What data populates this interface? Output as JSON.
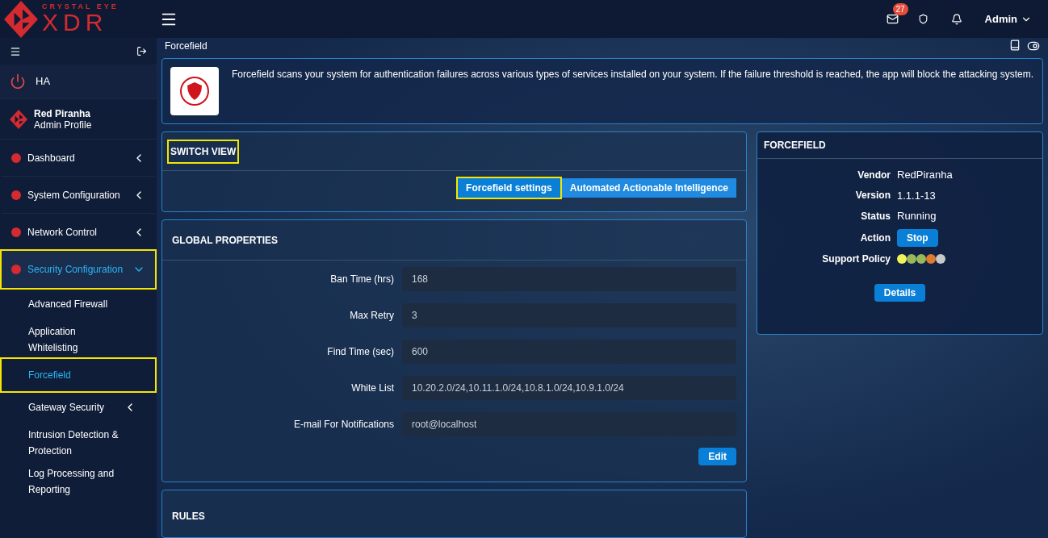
{
  "topbar": {
    "logo_top": "CRYSTAL EYE",
    "logo_main": "XDR",
    "mail_count": "27",
    "user": "Admin"
  },
  "sidebar": {
    "ha": "HA",
    "profile": {
      "name": "Red Piranha",
      "role": "Admin Profile"
    },
    "items": [
      {
        "label": "Dashboard",
        "expanded": false,
        "highlighted": false
      },
      {
        "label": "System Configuration",
        "expanded": false,
        "highlighted": false
      },
      {
        "label": "Network Control",
        "expanded": false,
        "highlighted": false
      },
      {
        "label": "Security Configuration",
        "expanded": true,
        "highlighted": true,
        "children": [
          {
            "label": "Advanced Firewall",
            "selected": false,
            "highlighted": false,
            "expandable": false
          },
          {
            "label": "Application Whitelisting",
            "selected": false,
            "highlighted": false,
            "expandable": false
          },
          {
            "label": "Forcefield",
            "selected": true,
            "highlighted": true,
            "expandable": false
          },
          {
            "label": "Gateway Security",
            "selected": false,
            "highlighted": false,
            "expandable": true
          },
          {
            "label": "Intrusion Detection & Protection",
            "selected": false,
            "highlighted": false,
            "expandable": false
          },
          {
            "label": "Log Processing and Reporting",
            "selected": false,
            "highlighted": false,
            "expandable": false
          }
        ]
      }
    ]
  },
  "breadcrumb": "Forcefield",
  "description": "Forcefield scans your system for authentication failures across various types of services installed on your system. If the failure threshold is reached, the app will block the attacking system.",
  "switch_view": {
    "title": "SWITCH VIEW",
    "highlighted": true,
    "tabs": [
      {
        "label": "Forcefield settings",
        "selected": true,
        "highlighted": true
      },
      {
        "label": "Automated Actionable Intelligence",
        "selected": false,
        "highlighted": false
      }
    ]
  },
  "global_properties": {
    "title": "GLOBAL PROPERTIES",
    "fields": [
      {
        "label": "Ban Time (hrs)",
        "value": "168"
      },
      {
        "label": "Max Retry",
        "value": "3"
      },
      {
        "label": "Find Time (sec)",
        "value": "600"
      },
      {
        "label": "White List",
        "value": "10.20.2.0/24,10.11.1.0/24,10.8.1.0/24,10.9.1.0/24"
      },
      {
        "label": "E-mail For Notifications",
        "value": "root@localhost"
      }
    ],
    "button": "Edit"
  },
  "rules": {
    "title": "RULES"
  },
  "app_card": {
    "title": "FORCEFIELD",
    "rows": [
      {
        "kind": "text",
        "label": "Vendor",
        "value": "RedPiranha"
      },
      {
        "kind": "text",
        "label": "Version",
        "value": "1.1.1-13"
      },
      {
        "kind": "text",
        "label": "Status",
        "value": "Running"
      },
      {
        "kind": "button",
        "label": "Action",
        "value": "Stop"
      },
      {
        "kind": "dots",
        "label": "Support Policy",
        "dots": [
          {
            "color": "#f2f25a"
          },
          {
            "color": "#9ab85a"
          },
          {
            "color": "#9ab85a"
          },
          {
            "color": "#e07b2e"
          },
          {
            "color": "#c8c8c8"
          }
        ]
      }
    ],
    "button": "Details"
  }
}
